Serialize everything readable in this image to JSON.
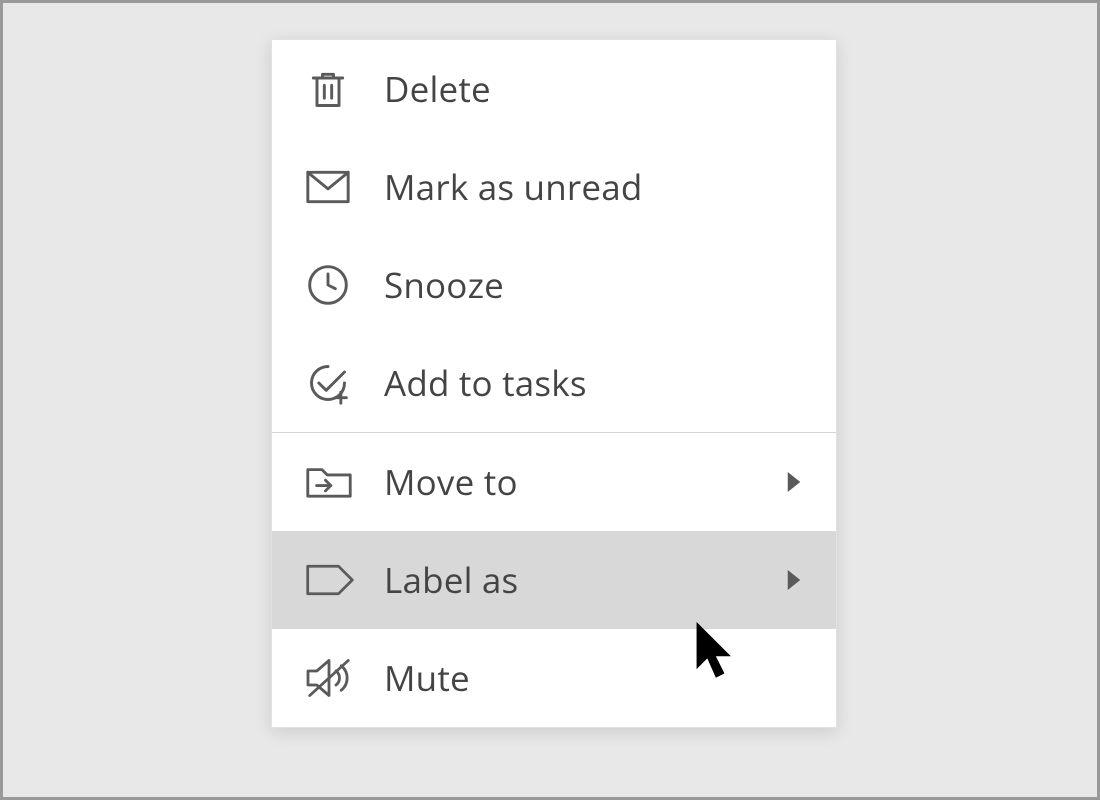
{
  "menu": {
    "items": [
      {
        "icon": "trash-icon",
        "label": "Delete",
        "hasSubmenu": false,
        "hovered": false
      },
      {
        "icon": "envelope-icon",
        "label": "Mark as unread",
        "hasSubmenu": false,
        "hovered": false
      },
      {
        "icon": "clock-icon",
        "label": "Snooze",
        "hasSubmenu": false,
        "hovered": false
      },
      {
        "icon": "add-task-icon",
        "label": "Add to tasks",
        "hasSubmenu": false,
        "hovered": false
      },
      {
        "separator": true
      },
      {
        "icon": "folder-move-icon",
        "label": "Move to",
        "hasSubmenu": true,
        "hovered": false
      },
      {
        "icon": "label-icon",
        "label": "Label as",
        "hasSubmenu": true,
        "hovered": true
      },
      {
        "icon": "mute-icon",
        "label": "Mute",
        "hasSubmenu": false,
        "hovered": false
      }
    ]
  },
  "colors": {
    "background": "#e8e8e8",
    "menuBg": "#ffffff",
    "hoverBg": "#d8d8d8",
    "text": "#444444",
    "iconStroke": "#5a5a5a",
    "separator": "#d4d4d4"
  }
}
